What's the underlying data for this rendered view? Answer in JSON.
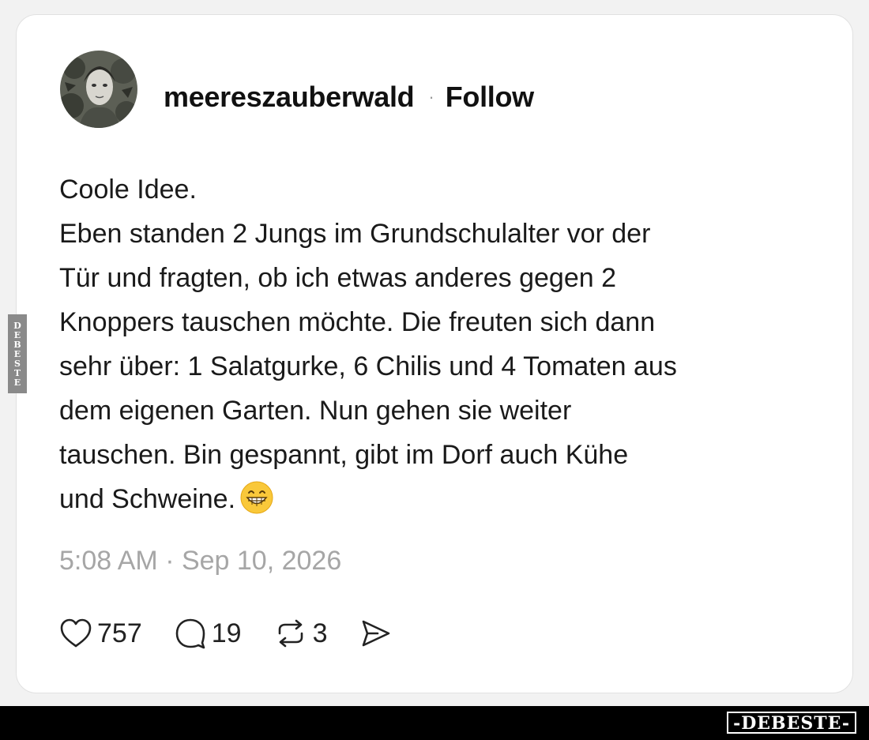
{
  "post": {
    "username": "meereszauberwald",
    "separator": "·",
    "follow_label": "Follow",
    "text_lines": [
      "Coole Idee.",
      "Eben standen 2 Jungs im Grundschulalter vor der",
      "Tür und fragten, ob ich etwas anderes gegen 2",
      "Knoppers tauschen möchte. Die freuten sich dann",
      "sehr über: 1 Salatgurke, 6 Chilis und 4 Tomaten aus",
      "dem eigenen Garten. Nun gehen sie weiter",
      "tauschen. Bin gespannt, gibt im Dorf auch Kühe",
      "und Schweine."
    ],
    "emoji": "grinning-face-emoji",
    "timestamp": "5:08 AM · Sep 10, 2026"
  },
  "actions": {
    "likes": "757",
    "comments": "19",
    "reposts": "3",
    "like_icon": "heart-icon",
    "comment_icon": "comment-bubble-icon",
    "repost_icon": "repost-icon",
    "share_icon": "send-icon"
  },
  "watermarks": {
    "side": "DEBESTE",
    "bottom": "-DEBESTE-"
  },
  "colors": {
    "card_background": "#ffffff",
    "page_background": "#f2f2f2",
    "timestamp": "#a6a6a6",
    "text": "#1a1a1a",
    "bottom_bar": "#000000"
  }
}
